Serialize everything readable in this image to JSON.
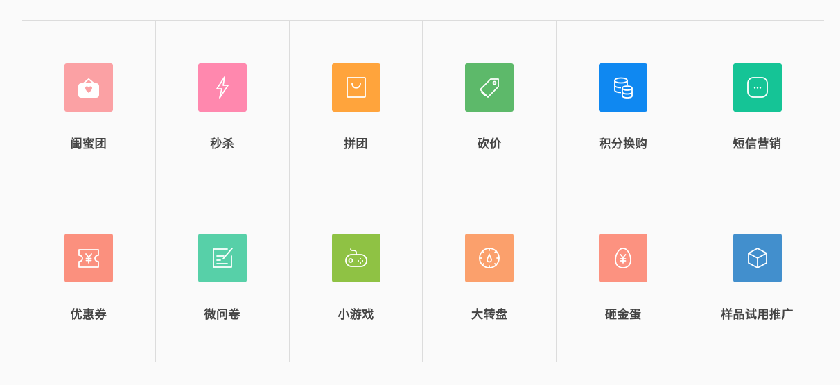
{
  "items": [
    {
      "label": "闺蜜团",
      "icon": "heart-envelope-icon",
      "color": "#fba1a4"
    },
    {
      "label": "秒杀",
      "icon": "lightning-icon",
      "color": "#ff88ae"
    },
    {
      "label": "拼团",
      "icon": "shopping-bag-icon",
      "color": "#ffa43c"
    },
    {
      "label": "砍价",
      "icon": "price-tag-icon",
      "color": "#5db96a"
    },
    {
      "label": "积分换购",
      "icon": "coins-icon",
      "color": "#0f88f1"
    },
    {
      "label": "短信营销",
      "icon": "message-icon",
      "color": "#15c496"
    },
    {
      "label": "优惠券",
      "icon": "coupon-icon",
      "color": "#fb907e"
    },
    {
      "label": "微问卷",
      "icon": "questionnaire-icon",
      "color": "#57d0a8"
    },
    {
      "label": "小游戏",
      "icon": "gamepad-icon",
      "color": "#8fc244"
    },
    {
      "label": "大转盘",
      "icon": "wheel-icon",
      "color": "#fba06c"
    },
    {
      "label": "砸金蛋",
      "icon": "golden-egg-icon",
      "color": "#fc9280"
    },
    {
      "label": "样品试用推广",
      "icon": "cube-icon",
      "color": "#428fcd"
    }
  ]
}
